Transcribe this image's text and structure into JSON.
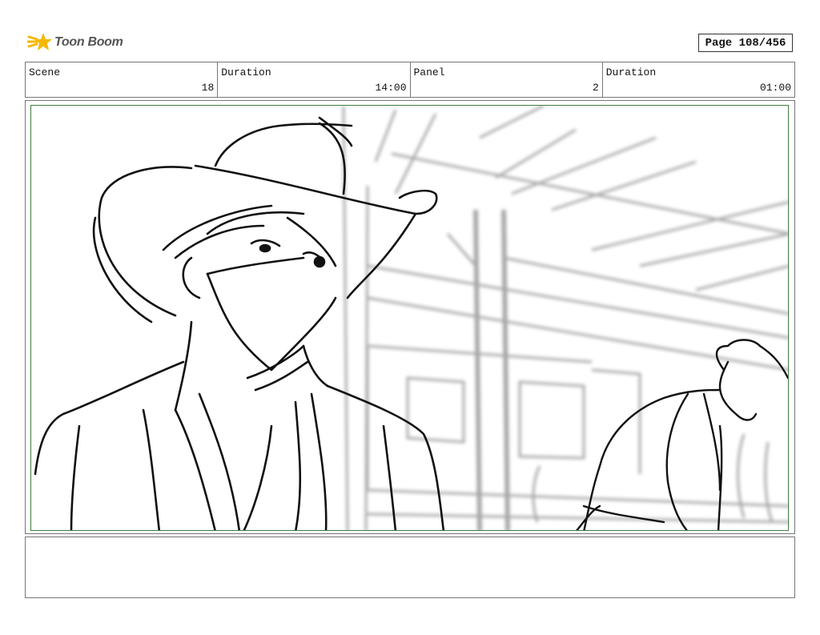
{
  "brand": {
    "name": "Toon Boom",
    "accent": "#f5b800"
  },
  "page": {
    "label": "Page 108/456"
  },
  "info": {
    "scene_label": "Scene",
    "scene_value": "18",
    "duration_label": "Duration",
    "duration_value": "14:00",
    "panel_label": "Panel",
    "panel_value": "2",
    "panel_duration_label": "Duration",
    "panel_duration_value": "01:00"
  },
  "panel": {
    "frame_color": "#3e7d3e",
    "illustration": "storyboard-sketch"
  },
  "notes": {
    "text": ""
  }
}
